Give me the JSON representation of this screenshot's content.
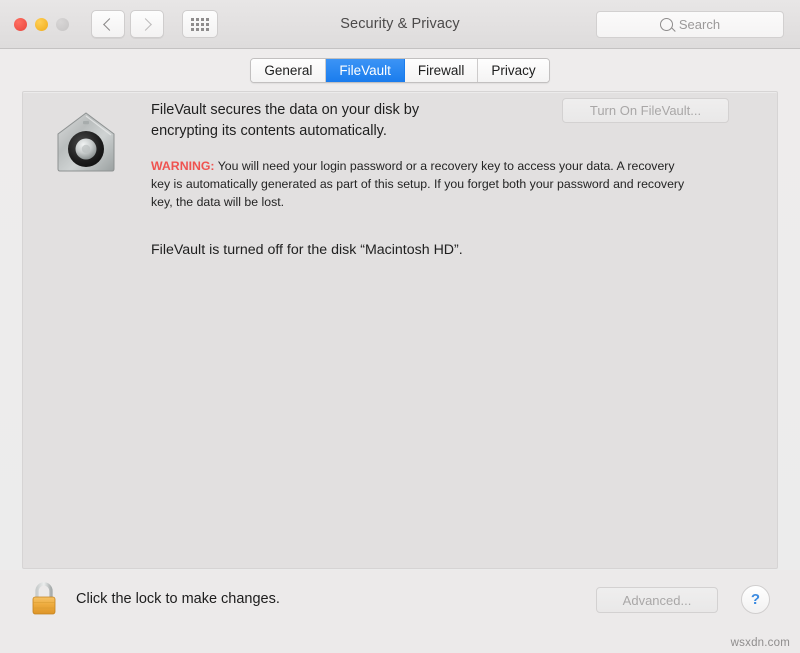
{
  "window": {
    "title": "Security & Privacy",
    "traffic_lights": [
      {
        "name": "close",
        "color": "#e8453c"
      },
      {
        "name": "minimize",
        "color": "#f0ab19"
      },
      {
        "name": "zoom",
        "color": "#c6c4c4"
      }
    ],
    "nav": {
      "back_label": "‹",
      "forward_label": "›",
      "show_all_label": "Show All"
    },
    "search": {
      "placeholder": "Search",
      "value": ""
    }
  },
  "tabs": [
    {
      "label": "General",
      "active": false
    },
    {
      "label": "FileVault",
      "active": true
    },
    {
      "label": "Firewall",
      "active": false
    },
    {
      "label": "Privacy",
      "active": false
    }
  ],
  "main": {
    "icon_name": "filevault-house-safe-icon",
    "description": "FileVault secures the data on your disk by encrypting its contents automatically.",
    "warning_label": "WARNING:",
    "warning_text": " You will need your login password or a recovery key to access your data. A recovery key is automatically generated as part of this setup. If you forget both your password and recovery key, the data will be lost.",
    "status": "FileVault is turned off for the disk “Macintosh HD”.",
    "turn_on_button": "Turn On FileVault...",
    "turn_on_disabled": true
  },
  "footer": {
    "lock_text": "Click the lock to make changes.",
    "lock_state": "locked",
    "advanced_button": "Advanced...",
    "advanced_disabled": true,
    "help_button": "?"
  },
  "watermark": "wsxdn.com",
  "colors": {
    "accent_blue": "#1a7ced",
    "warning_red": "#ef5350",
    "help_blue": "#3b8ae0",
    "panel_bg": "#e2e0e0",
    "window_bg": "#eceaea"
  }
}
